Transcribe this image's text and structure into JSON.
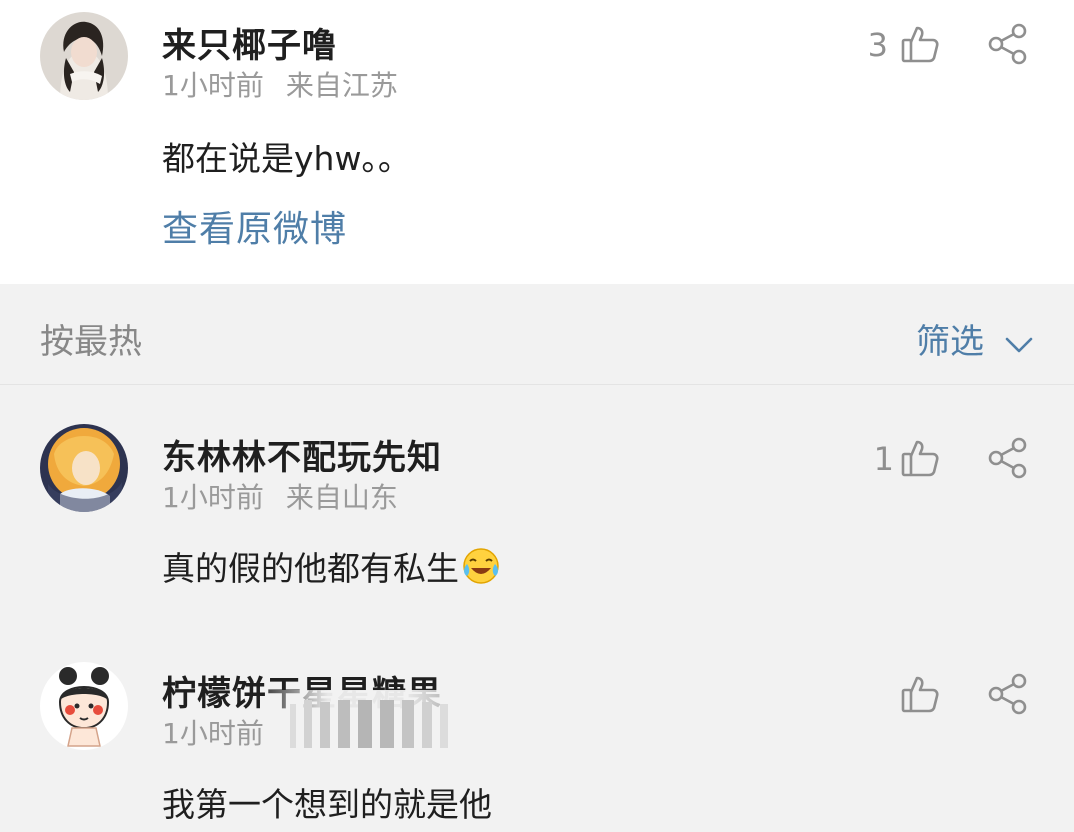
{
  "top_comment": {
    "username": "来只椰子噜",
    "time": "1小时前",
    "location": "来自江苏",
    "text": "都在说是yhw。。",
    "likes": "3",
    "view_original": "查看原微博"
  },
  "sort_bar": {
    "sort_label": "按最热",
    "filter_label": "筛选"
  },
  "comments": [
    {
      "username": "东林林不配玩先知",
      "time": "1小时前",
      "location": "来自山东",
      "text": "真的假的他都有私生",
      "emoji": "laughing-crying-emoji",
      "likes": "1"
    },
    {
      "username": "柠檬饼干星星糖果",
      "time": "1小时前",
      "location": "",
      "text": "我第一个想到的就是他",
      "likes": ""
    }
  ],
  "icons": {
    "like": "thumbs-up-icon",
    "share": "share-icon",
    "chevron": "chevron-down-icon"
  },
  "colors": {
    "link": "#4f7ea8",
    "muted": "#9a9a9a",
    "background": "#f2f2f2",
    "card": "#ffffff"
  }
}
